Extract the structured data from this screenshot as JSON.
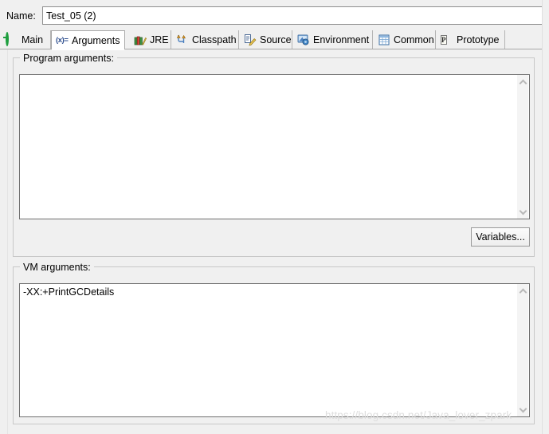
{
  "dialog": {
    "name_label": "Name:",
    "name_value": "Test_05 (2)"
  },
  "tabs": [
    {
      "id": "main",
      "label": "Main",
      "icon": "green-circle-g-icon",
      "selected": false
    },
    {
      "id": "arguments",
      "label": "Arguments",
      "icon": "variable-xequals-icon",
      "selected": true
    },
    {
      "id": "jre",
      "label": "JRE",
      "icon": "books-icon",
      "selected": false
    },
    {
      "id": "classpath",
      "label": "Classpath",
      "icon": "classpath-arrows-icon",
      "selected": false
    },
    {
      "id": "source",
      "label": "Source",
      "icon": "source-pencil-icon",
      "selected": false
    },
    {
      "id": "environment",
      "label": "Environment",
      "icon": "monitor-icon",
      "selected": false
    },
    {
      "id": "common",
      "label": "Common",
      "icon": "table-icon",
      "selected": false
    },
    {
      "id": "prototype",
      "label": "Prototype",
      "icon": "prototype-p-icon",
      "selected": false
    }
  ],
  "program_arguments": {
    "group_title": "Program arguments:",
    "value": "",
    "variables_button": "Variables..."
  },
  "vm_arguments": {
    "group_title": "VM arguments:",
    "value": "-XX:+PrintGCDetails"
  },
  "watermark": {
    "text": "https://blog.csdn.net/Java_lover_zpark"
  },
  "colors": {
    "surface": "#f0f0f0",
    "field_bg": "#ffffff",
    "field_border": "#6f6f6f",
    "group_border": "#c8c8c8",
    "tab_border": "#a8a8a8",
    "accent_green": "#1e9e3e",
    "accent_blue": "#2f4f8f",
    "watermark": "#dedede"
  }
}
